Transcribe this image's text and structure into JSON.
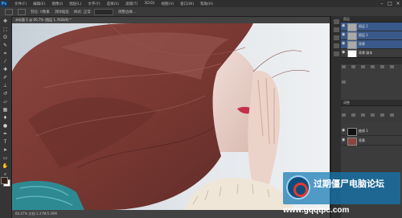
{
  "menubar": {
    "logo": "Ps",
    "items": [
      "文件(F)",
      "编辑(E)",
      "图像(I)",
      "图层(L)",
      "文字(Y)",
      "选择(S)",
      "滤镜(T)",
      "3D(D)",
      "视图(V)",
      "窗口(W)",
      "帮助(H)"
    ],
    "window_controls": [
      "–",
      "□",
      "×"
    ]
  },
  "options_bar": {
    "items": [
      "羽化: 0像素",
      "消除锯齿",
      "样式: 正常",
      "调整边缘..."
    ]
  },
  "document": {
    "tab_label": "未标题-1 @ 66.7% (图层 1, RGB/8) *",
    "status": "66.67%   文档:1.37M/5.49M"
  },
  "layers_panel": {
    "header": "图层",
    "adjust_header": "调整",
    "layers": [
      {
        "name": "图层 2",
        "active": true
      },
      {
        "name": "图层 1",
        "active": true
      },
      {
        "name": "背景",
        "active": true
      },
      {
        "name": "背景 副本",
        "active": false
      }
    ],
    "lower_layers": [
      {
        "name": "曲线 1"
      },
      {
        "name": "背景"
      }
    ]
  },
  "watermark": {
    "title": "过期僵尸电脑论坛",
    "url": "www.gqqtpc.com"
  },
  "colors": {
    "menubar": "#2f2f2f",
    "panel": "#3c3c3c",
    "selected_layer": "#39598b",
    "hair": "#7c3a34",
    "watermark": "#1e78b4"
  }
}
